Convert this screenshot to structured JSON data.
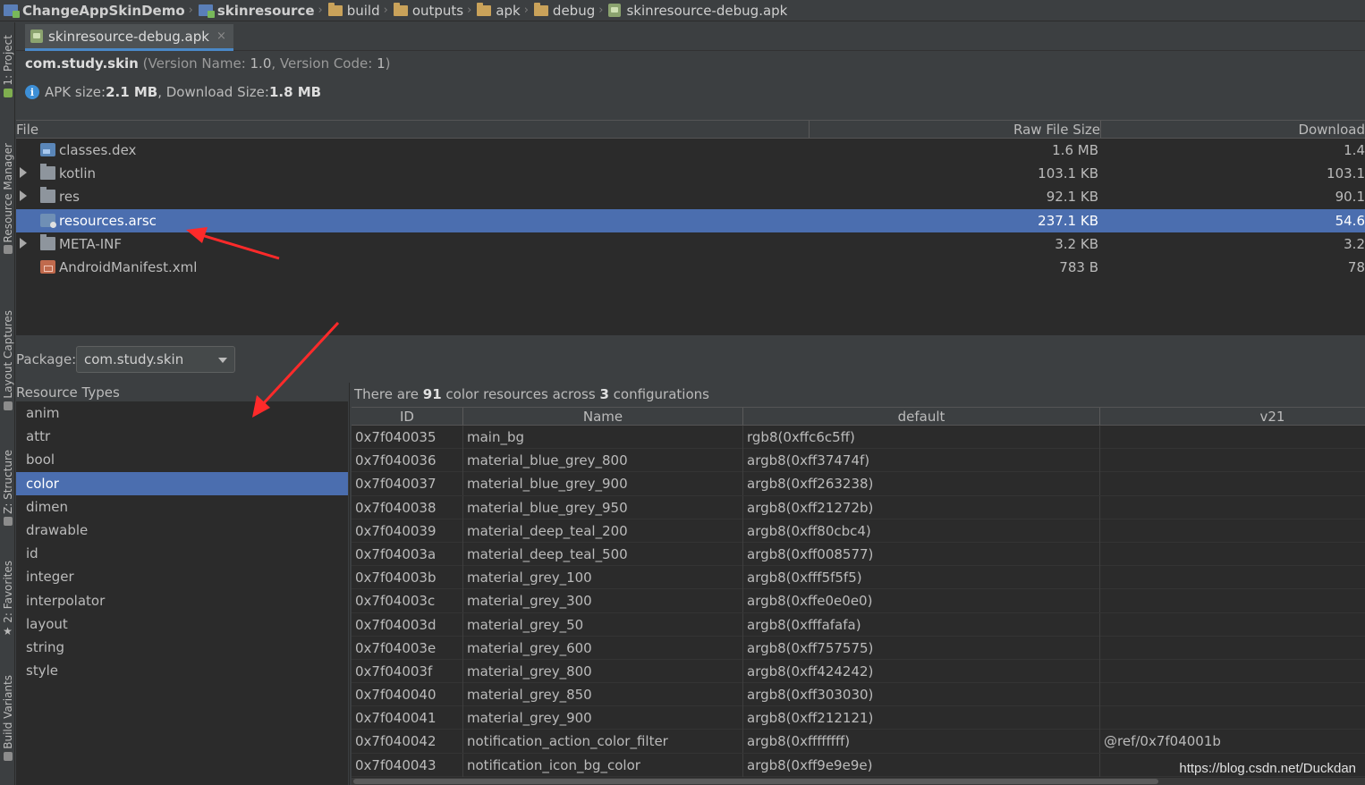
{
  "breadcrumb": [
    {
      "label": "ChangeAppSkinDemo",
      "icon": "module-icon",
      "bold": true
    },
    {
      "label": "skinresource",
      "icon": "module-icon",
      "bold": true
    },
    {
      "label": "build",
      "icon": "folder-icon",
      "bold": false
    },
    {
      "label": "outputs",
      "icon": "folder-icon",
      "bold": false
    },
    {
      "label": "apk",
      "icon": "folder-icon",
      "bold": false
    },
    {
      "label": "debug",
      "icon": "folder-icon",
      "bold": false
    },
    {
      "label": "skinresource-debug.apk",
      "icon": "apk-icon",
      "bold": false
    }
  ],
  "toolstrip": {
    "project": "1: Project",
    "resource_manager": "Resource Manager",
    "layout_captures": "Layout Captures",
    "structure": "Z: Structure",
    "favorites": "2: Favorites",
    "build_variants": "Build Variants"
  },
  "tab": {
    "label": "skinresource-debug.apk",
    "close": "×"
  },
  "summary": {
    "package": "com.study.skin",
    "version_prefix": "(Version Name: ",
    "version_name": "1.0",
    "version_mid": ", Version Code: ",
    "version_code": "1",
    "version_suffix": ")",
    "apk_size_label": "APK size: ",
    "apk_size": "2.1 MB",
    "download_label": ", Download Size: ",
    "download_size": "1.8 MB"
  },
  "file_table": {
    "headers": {
      "file": "File",
      "raw": "Raw File Size",
      "download": "Download"
    },
    "rows": [
      {
        "name": "classes.dex",
        "raw": "1.6 MB",
        "download": "1.4",
        "icon": "dex",
        "expandable": false,
        "selected": false
      },
      {
        "name": "kotlin",
        "raw": "103.1 KB",
        "download": "103.1",
        "icon": "folder",
        "expandable": true,
        "selected": false
      },
      {
        "name": "res",
        "raw": "92.1 KB",
        "download": "90.1",
        "icon": "folder",
        "expandable": true,
        "selected": false
      },
      {
        "name": "resources.arsc",
        "raw": "237.1 KB",
        "download": "54.6",
        "icon": "arsc",
        "expandable": false,
        "selected": true
      },
      {
        "name": "META-INF",
        "raw": "3.2 KB",
        "download": "3.2",
        "icon": "folder",
        "expandable": true,
        "selected": false
      },
      {
        "name": "AndroidManifest.xml",
        "raw": "783 B",
        "download": "78",
        "icon": "xml",
        "expandable": false,
        "selected": false
      }
    ]
  },
  "package_selector": {
    "label": "Package:",
    "value": "com.study.skin"
  },
  "resource_types": {
    "title": "Resource Types",
    "items": [
      "anim",
      "attr",
      "bool",
      "color",
      "dimen",
      "drawable",
      "id",
      "integer",
      "interpolator",
      "layout",
      "string",
      "style"
    ],
    "selected": "color"
  },
  "resource_summary": {
    "prefix": "There are ",
    "count": "91",
    "mid": " color resources across ",
    "configs": "3",
    "suffix": " configurations"
  },
  "resource_table": {
    "headers": {
      "id": "ID",
      "name": "Name",
      "default": "default",
      "v21": "v21"
    },
    "rows": [
      {
        "id": "0x7f040035",
        "name": "main_bg",
        "default": "rgb8(0xffc6c5ff)",
        "v21": ""
      },
      {
        "id": "0x7f040036",
        "name": "material_blue_grey_800",
        "default": "argb8(0xff37474f)",
        "v21": ""
      },
      {
        "id": "0x7f040037",
        "name": "material_blue_grey_900",
        "default": "argb8(0xff263238)",
        "v21": ""
      },
      {
        "id": "0x7f040038",
        "name": "material_blue_grey_950",
        "default": "argb8(0xff21272b)",
        "v21": ""
      },
      {
        "id": "0x7f040039",
        "name": "material_deep_teal_200",
        "default": "argb8(0xff80cbc4)",
        "v21": ""
      },
      {
        "id": "0x7f04003a",
        "name": "material_deep_teal_500",
        "default": "argb8(0xff008577)",
        "v21": ""
      },
      {
        "id": "0x7f04003b",
        "name": "material_grey_100",
        "default": "argb8(0xfff5f5f5)",
        "v21": ""
      },
      {
        "id": "0x7f04003c",
        "name": "material_grey_300",
        "default": "argb8(0xffe0e0e0)",
        "v21": ""
      },
      {
        "id": "0x7f04003d",
        "name": "material_grey_50",
        "default": "argb8(0xfffafafa)",
        "v21": ""
      },
      {
        "id": "0x7f04003e",
        "name": "material_grey_600",
        "default": "argb8(0xff757575)",
        "v21": ""
      },
      {
        "id": "0x7f04003f",
        "name": "material_grey_800",
        "default": "argb8(0xff424242)",
        "v21": ""
      },
      {
        "id": "0x7f040040",
        "name": "material_grey_850",
        "default": "argb8(0xff303030)",
        "v21": ""
      },
      {
        "id": "0x7f040041",
        "name": "material_grey_900",
        "default": "argb8(0xff212121)",
        "v21": ""
      },
      {
        "id": "0x7f040042",
        "name": "notification_action_color_filter",
        "default": "argb8(0xffffffff)",
        "v21": "@ref/0x7f04001b"
      },
      {
        "id": "0x7f040043",
        "name": "notification_icon_bg_color",
        "default": "argb8(0xff9e9e9e)",
        "v21": ""
      }
    ]
  },
  "watermark": "https://blog.csdn.net/Duckdan",
  "colors": {
    "selection": "#4b6eaf",
    "annotation_arrow": "#ff2a2a",
    "background": "#2b2b2b"
  }
}
